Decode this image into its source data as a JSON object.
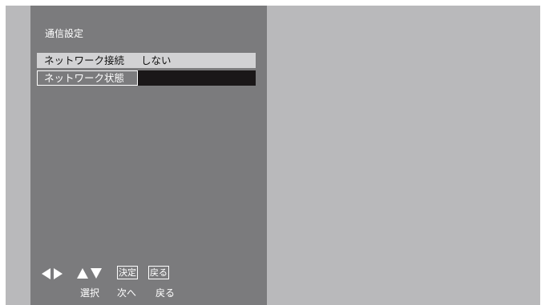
{
  "panel": {
    "title": "通信設定"
  },
  "menu": {
    "items": [
      {
        "label": "ネットワーク接続",
        "value": "しない"
      },
      {
        "label": "ネットワーク状態",
        "value": ""
      }
    ]
  },
  "footer": {
    "icons": [
      "left-arrow-icon",
      "right-arrow-icon",
      "up-arrow-icon",
      "down-arrow-icon"
    ],
    "keys": {
      "ok": "決定",
      "back": "戻る"
    },
    "hints": {
      "select": "選択",
      "next": "次へ",
      "back": "戻る"
    }
  }
}
